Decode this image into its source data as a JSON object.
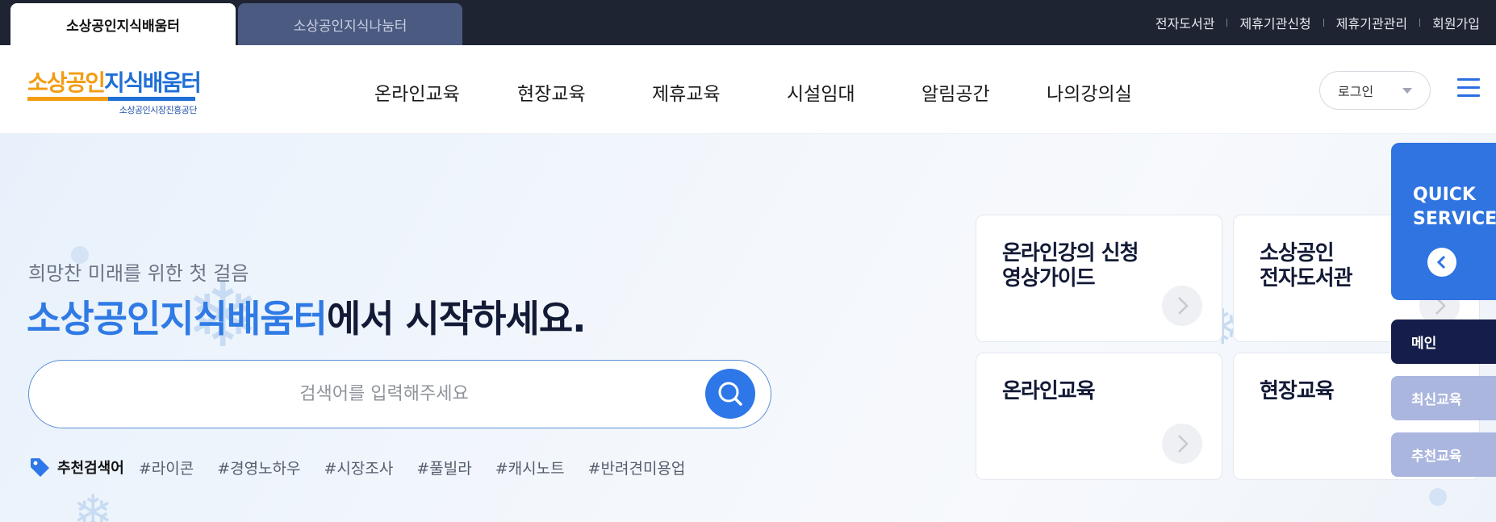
{
  "topbar": {
    "site_tabs": [
      {
        "label": "소상공인지식배움터",
        "active": true
      },
      {
        "label": "소상공인지식나눔터",
        "active": false
      }
    ],
    "util_links": [
      "전자도서관",
      "제휴기관신청",
      "제휴기관관리",
      "회원가입"
    ]
  },
  "header": {
    "logo": {
      "text_orange": "소상공인",
      "text_blue": "지식배움터",
      "sub": "소상공인시장진흥공단"
    },
    "nav": [
      "온라인교육",
      "현장교육",
      "제휴교육",
      "시설임대",
      "알림공간",
      "나의강의실"
    ],
    "login_label": "로그인",
    "menu_icon": "hamburger-menu-icon"
  },
  "hero": {
    "subtitle": "희망찬 미래를 위한 첫 걸음",
    "title_highlight": "소상공인지식배움터",
    "title_rest": "에서 시작하세요.",
    "search_placeholder": "검색어를 입력해주세요",
    "recommend_label": "추천검색어",
    "recommend_tags": [
      "#라이콘",
      "#경영노하우",
      "#시장조사",
      "#풀빌라",
      "#캐시노트",
      "#반려견미용업"
    ]
  },
  "cards": [
    {
      "title": "온라인강의 신청\n영상가이드"
    },
    {
      "title": "소상공인\n전자도서관"
    },
    {
      "title": "온라인교육"
    },
    {
      "title": "현장교육"
    }
  ],
  "quick_service": {
    "title": "QUICK\nSERVICE",
    "items": [
      "메인",
      "최신교육",
      "추천교육"
    ]
  },
  "colors": {
    "topbar_bg": "#1e2432",
    "primary_blue": "#2f74e0",
    "logo_orange": "#f39c12",
    "quick_active": "#151e4a",
    "quick_inactive": "#aab6de"
  }
}
